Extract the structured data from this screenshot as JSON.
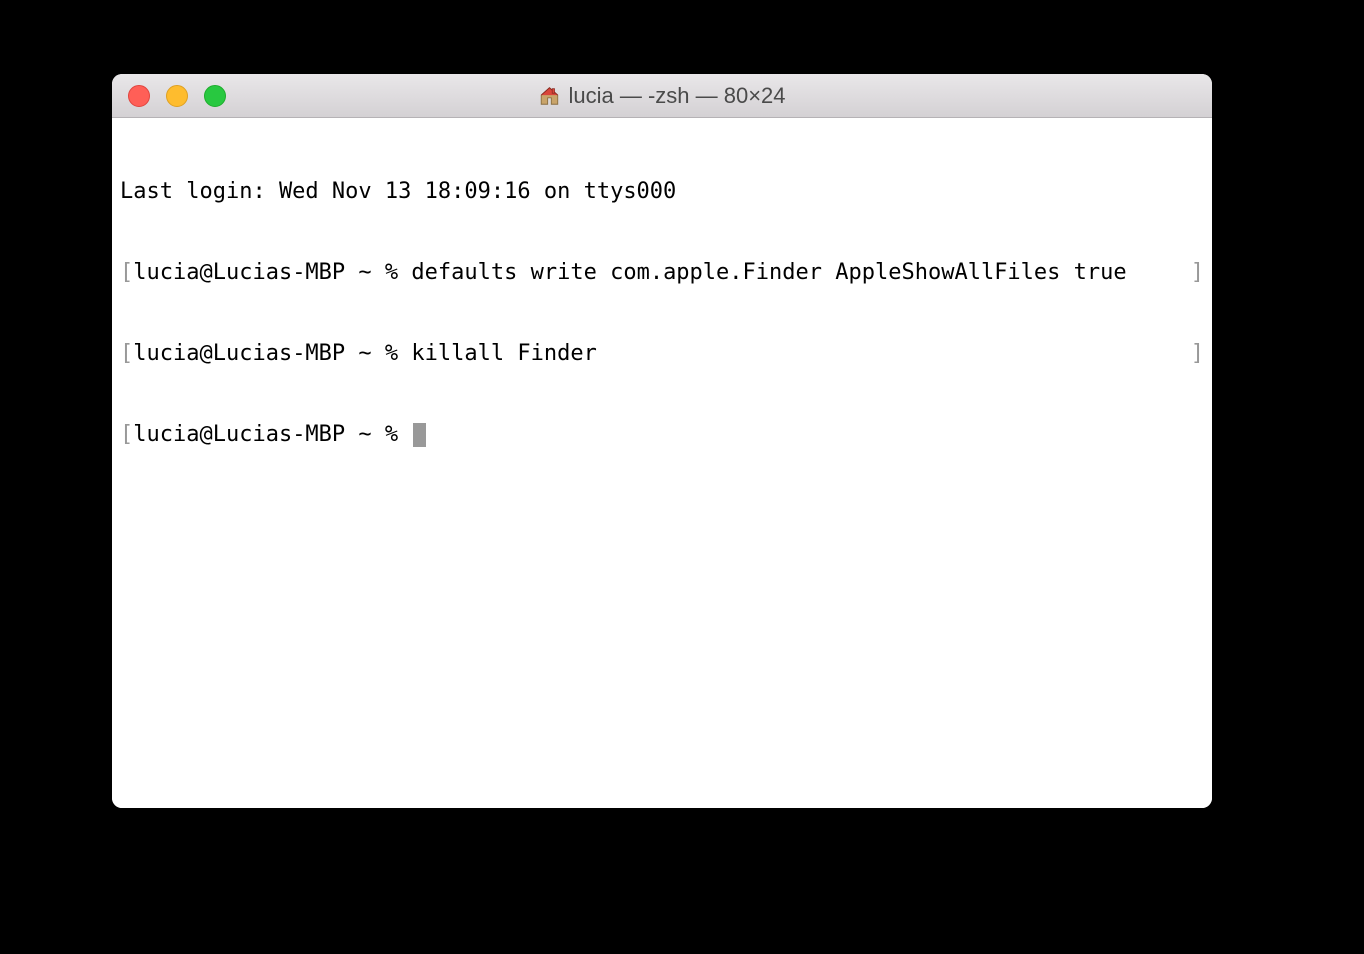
{
  "window": {
    "title": "lucia — -zsh — 80×24",
    "home_icon": "home-icon"
  },
  "traffic": {
    "close": "close",
    "minimize": "minimize",
    "zoom": "zoom"
  },
  "terminal": {
    "last_login": "Last login: Wed Nov 13 18:09:16 on ttys000",
    "bracket_open": "[",
    "bracket_close": "]",
    "lines": [
      {
        "prompt": "lucia@Lucias-MBP ~ % ",
        "command": "defaults write com.apple.Finder AppleShowAllFiles true"
      },
      {
        "prompt": "lucia@Lucias-MBP ~ % ",
        "command": "killall Finder"
      }
    ],
    "current_prompt": "lucia@Lucias-MBP ~ % "
  }
}
